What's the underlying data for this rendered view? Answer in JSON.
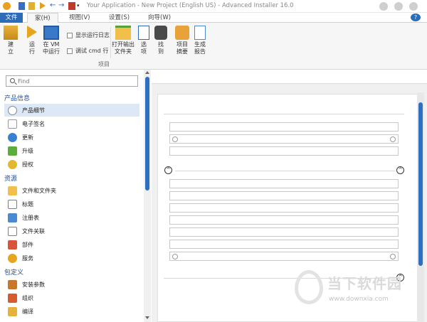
{
  "window": {
    "title": "Your Application - New Project (English US) - Advanced Installer 16.0"
  },
  "menu": {
    "file": "文件",
    "tabs": [
      "家(H)",
      "视图(V)",
      "设置(S)",
      "向导(W)"
    ],
    "help": "?"
  },
  "ribbon": {
    "build": "建\n立",
    "run": "运\n行",
    "run_vm": "在 VM\n中运行",
    "show_log": "显示运行日志",
    "debug_cmd": "调试 cmd 行",
    "open_output": "打开输出\n文件夹",
    "options": "选\n项",
    "find": "找\n到",
    "project_summary": "项目\n摘要",
    "report": "生成\n报告",
    "group_label": "项目"
  },
  "search": {
    "placeholder": "Find"
  },
  "nav": {
    "cat1": "产品信息",
    "cat1_items": [
      "产品细节",
      "电子签名",
      "更新",
      "升级",
      "授权"
    ],
    "cat2": "资源",
    "cat2_items": [
      "文件和文件夹",
      "标题",
      "注册表",
      "文件关联",
      "部件",
      "服务"
    ],
    "cat3": "包定义",
    "cat3_items": [
      "安装参数",
      "组织",
      "编译"
    ]
  },
  "watermark": {
    "cn": "当下软件园",
    "url": "www.downxia.com"
  },
  "colors": {
    "accent": "#2d6ab8",
    "scroll": "#2f6fbf",
    "selected": "#dce8f6"
  }
}
